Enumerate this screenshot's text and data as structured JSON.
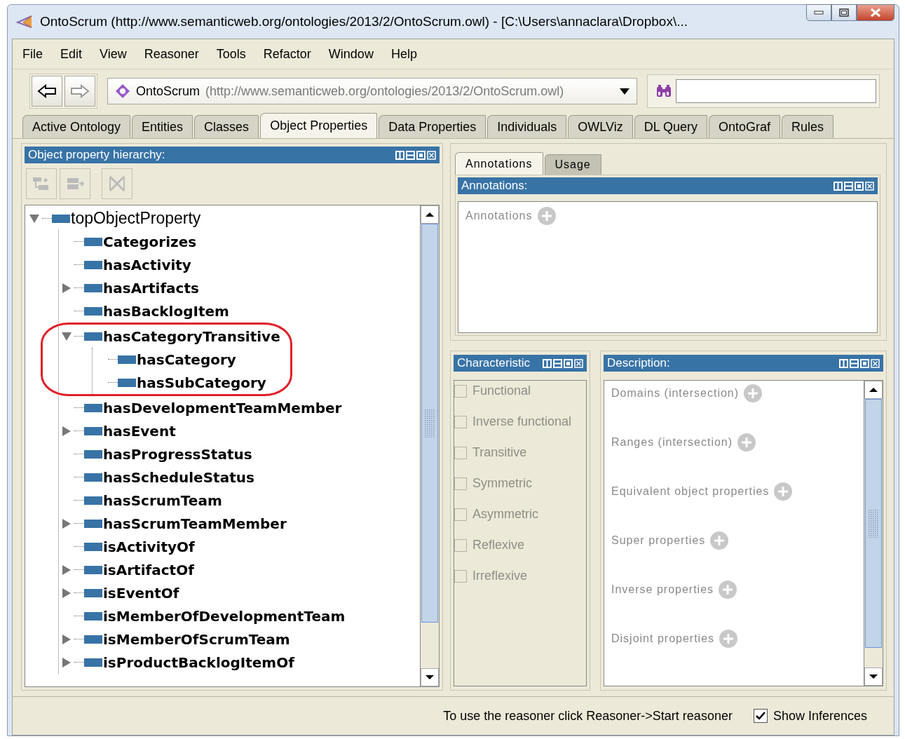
{
  "window": {
    "title": "OntoScrum (http://www.semanticweb.org/ontologies/2013/2/OntoScrum.owl) - [C:\\Users\\annaclara\\Dropbox\\..."
  },
  "menu": [
    "File",
    "Edit",
    "View",
    "Reasoner",
    "Tools",
    "Refactor",
    "Window",
    "Help"
  ],
  "toolbar": {
    "ontology": {
      "name": "OntoScrum",
      "iri": "(http://www.semanticweb.org/ontologies/2013/2/OntoScrum.owl)"
    }
  },
  "tabs": [
    {
      "label": "Active Ontology",
      "selected": false
    },
    {
      "label": "Entities",
      "selected": false
    },
    {
      "label": "Classes",
      "selected": false
    },
    {
      "label": "Object Properties",
      "selected": true
    },
    {
      "label": "Data Properties",
      "selected": false
    },
    {
      "label": "Individuals",
      "selected": false
    },
    {
      "label": "OWLViz",
      "selected": false
    },
    {
      "label": "DL Query",
      "selected": false
    },
    {
      "label": "OntoGraf",
      "selected": false
    },
    {
      "label": "Rules",
      "selected": false
    }
  ],
  "hierarchy": {
    "title": "Object property hierarchy:",
    "tree": {
      "label": "topObjectProperty",
      "kind": "root",
      "expanded": true,
      "children": [
        {
          "label": "Categorizes",
          "kind": "leaf",
          "expanded": false,
          "highlighted": false
        },
        {
          "label": "hasActivity",
          "kind": "leaf",
          "expanded": false,
          "highlighted": false
        },
        {
          "label": "hasArtifacts",
          "kind": "branch",
          "expanded": false,
          "highlighted": false
        },
        {
          "label": "hasBacklogItem",
          "kind": "leaf",
          "expanded": false,
          "highlighted": false
        },
        {
          "label": "hasCategoryTransitive",
          "kind": "branch",
          "expanded": true,
          "highlighted": true,
          "children": [
            {
              "label": "hasCategory",
              "kind": "leaf",
              "expanded": false,
              "highlighted": false
            },
            {
              "label": "hasSubCategory",
              "kind": "leaf",
              "expanded": false,
              "highlighted": false
            }
          ]
        },
        {
          "label": "hasDevelopmentTeamMember",
          "kind": "leaf",
          "expanded": false,
          "highlighted": false
        },
        {
          "label": "hasEvent",
          "kind": "branch",
          "expanded": false,
          "highlighted": false
        },
        {
          "label": "hasProgressStatus",
          "kind": "leaf",
          "expanded": false,
          "highlighted": false
        },
        {
          "label": "hasScheduleStatus",
          "kind": "leaf",
          "expanded": false,
          "highlighted": false
        },
        {
          "label": "hasScrumTeam",
          "kind": "leaf",
          "expanded": false,
          "highlighted": false
        },
        {
          "label": "hasScrumTeamMember",
          "kind": "branch",
          "expanded": false,
          "highlighted": false
        },
        {
          "label": "isActivityOf",
          "kind": "leaf",
          "expanded": false,
          "highlighted": false
        },
        {
          "label": "isArtifactOf",
          "kind": "branch",
          "expanded": false,
          "highlighted": false
        },
        {
          "label": "isEventOf",
          "kind": "branch",
          "expanded": false,
          "highlighted": false
        },
        {
          "label": "isMemberOfDevelopmentTeam",
          "kind": "leaf",
          "expanded": false,
          "highlighted": false
        },
        {
          "label": "isMemberOfScrumTeam",
          "kind": "branch",
          "expanded": false,
          "highlighted": false
        },
        {
          "label": "isProductBacklogItemOf",
          "kind": "branch",
          "expanded": false,
          "highlighted": false
        }
      ]
    }
  },
  "annotations": {
    "tabs": [
      {
        "label": "Annotations",
        "selected": true
      },
      {
        "label": "Usage",
        "selected": false
      }
    ],
    "title": "Annotations:",
    "items": [
      "Annotations"
    ]
  },
  "characteristics": {
    "title": "Characteristic",
    "items": [
      {
        "label": "Functional",
        "checked": false,
        "disabled": true
      },
      {
        "label": "Inverse functional",
        "checked": false,
        "disabled": true
      },
      {
        "label": "Transitive",
        "checked": false,
        "disabled": true
      },
      {
        "label": "Symmetric",
        "checked": false,
        "disabled": true
      },
      {
        "label": "Asymmetric",
        "checked": false,
        "disabled": true
      },
      {
        "label": "Reflexive",
        "checked": false,
        "disabled": true
      },
      {
        "label": "Irreflexive",
        "checked": false,
        "disabled": true
      }
    ]
  },
  "description": {
    "title": "Description:",
    "sections": [
      "Domains (intersection)",
      "Ranges (intersection)",
      "Equivalent object properties",
      "Super properties",
      "Inverse properties",
      "Disjoint properties"
    ]
  },
  "status": {
    "message": "To use the reasoner click Reasoner->Start reasoner",
    "show_inferences": {
      "label": "Show Inferences",
      "checked": true
    }
  }
}
